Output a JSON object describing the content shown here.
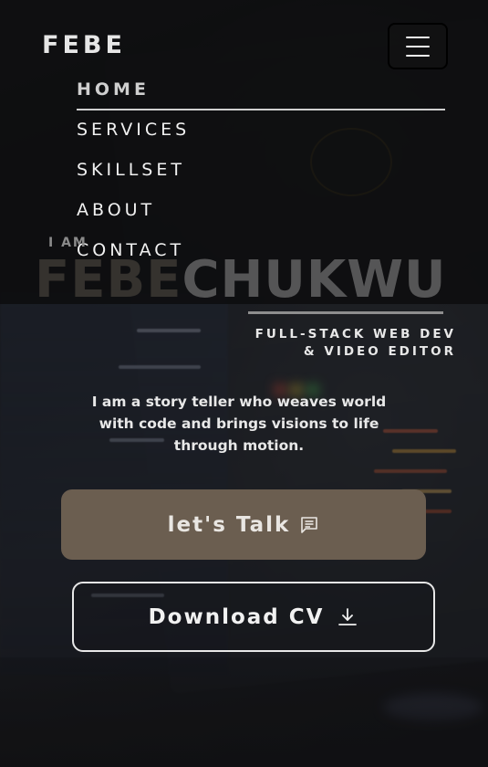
{
  "header": {
    "brand": "FEBE",
    "menu_icon": "hamburger-menu-icon"
  },
  "nav": {
    "items": [
      {
        "label": "HOME",
        "active": true
      },
      {
        "label": "SERVICES",
        "active": false
      },
      {
        "label": "SKILLSET",
        "active": false
      },
      {
        "label": "ABOUT",
        "active": false
      },
      {
        "label": "CONTACT",
        "active": false
      }
    ]
  },
  "hero": {
    "intro": "I AM",
    "first_name": "FEBE",
    "last_name": "CHUKWU",
    "role_line1": "FULL-STACK WEB DEV",
    "role_line2": "& VIDEO EDITOR",
    "tagline": "I am a story teller who weaves world with code and brings visions to life through motion."
  },
  "actions": {
    "talk_label": "let's Talk",
    "talk_icon": "message-square-icon",
    "cv_label": "Download CV",
    "cv_icon": "download-icon"
  },
  "colors": {
    "talk_button_bg": "#6b5e50",
    "overlay": "#0c0c0e",
    "text": "#e8e8e8"
  }
}
